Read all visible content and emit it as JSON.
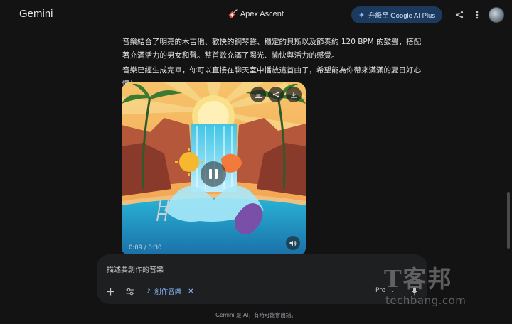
{
  "header": {
    "brand": "Gemini",
    "title_emoji": "🎸",
    "title": "Apex Ascent",
    "upgrade_label": "升級至 Google AI Plus",
    "share_icon": "share-icon",
    "more_icon": "more-vert-icon"
  },
  "response": {
    "paragraph_1": "音樂結合了明亮的木吉他、歡快的鋼琴聲、穩定的貝斯以及節奏約 120 BPM 的鼓聲，搭配著充滿活力的男女和聲。整首歌充滿了陽光、愉快與活力的感覺。",
    "paragraph_2": "音樂已經生成完畢，你可以直接在聊天室中播放這首曲子，希望能為你帶來滿滿的夏日好心情！"
  },
  "player": {
    "time": "0:09 / 0:30",
    "buttons": [
      "captions-icon",
      "share-icon",
      "download-icon",
      "pause-icon",
      "volume-icon"
    ]
  },
  "composer": {
    "placeholder": "描述要創作的音樂",
    "tool_chip": "創作音樂",
    "model": "Pro"
  },
  "footer": {
    "disclaimer": "Gemini 是 AI，有時可能會出錯。"
  },
  "watermark": {
    "big": "T客邦",
    "small": "techbang.com"
  },
  "colors": {
    "background": "#131314",
    "accent": "#8ab4f8",
    "upgrade_bg": "#1b3a5e",
    "composer_bg": "#1e1f20"
  }
}
